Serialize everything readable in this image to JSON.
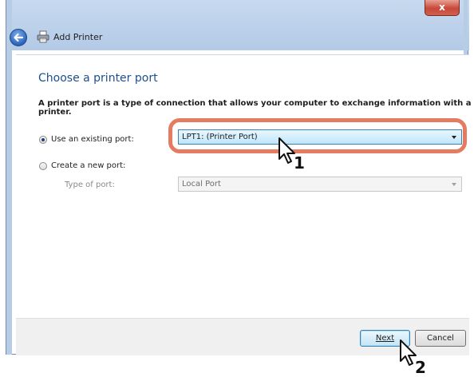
{
  "window": {
    "title": "Add Printer",
    "close_label": "x"
  },
  "page": {
    "heading": "Choose a printer port",
    "description": "A printer port is a type of connection that allows your computer to exchange information with a printer."
  },
  "options": {
    "existing": {
      "label": "Use an existing port:",
      "selected": true,
      "value": "LPT1: (Printer Port)"
    },
    "create": {
      "label": "Create a new port:",
      "selected": false
    },
    "type_label": "Type of port:",
    "type_value": "Local Port"
  },
  "buttons": {
    "next_label": "Next",
    "cancel_label": "Cancel"
  },
  "annotations": {
    "step1": "1",
    "step2": "2",
    "highlight_color": "#e57c62"
  },
  "icons": {
    "back": "back-arrow-icon",
    "printer": "printer-icon",
    "cursor": "mouse-pointer-icon"
  }
}
